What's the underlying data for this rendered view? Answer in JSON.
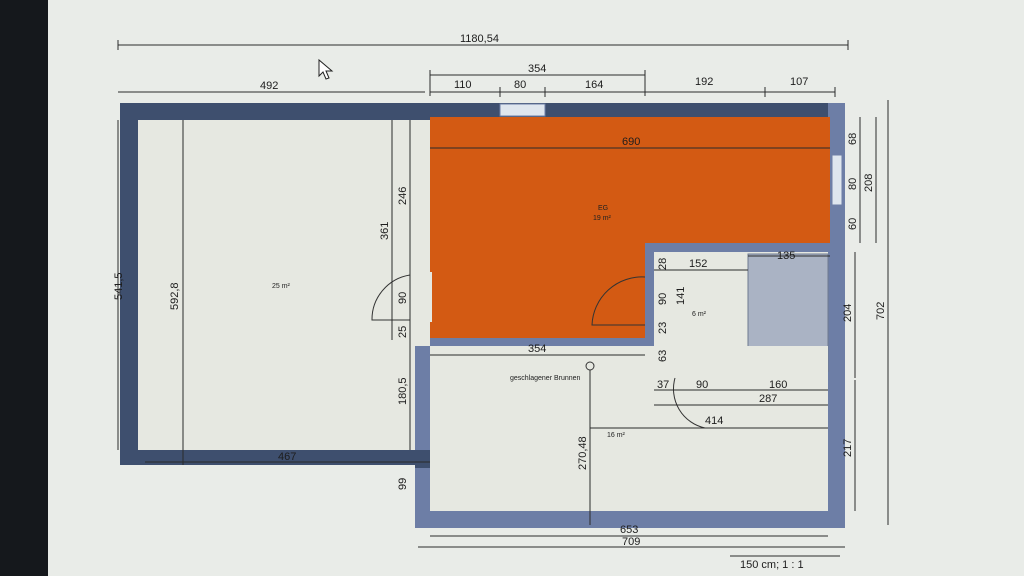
{
  "plan": {
    "dimensions": {
      "total_width": "1180,54",
      "top_left": "492",
      "top_mid_group": "354",
      "seg_110": "110",
      "seg_80": "80",
      "seg_164": "164",
      "seg_192": "192",
      "seg_107": "107",
      "orange_width": "690",
      "right_68": "68",
      "right_80": "80",
      "right_60": "60",
      "right_208": "208",
      "right_702": "702",
      "right_204": "204",
      "right_217": "217",
      "left_541": "541,5",
      "left_592": "592,8",
      "inner_246": "246",
      "inner_361": "361",
      "inner_90": "90",
      "inner_25": "25",
      "inner_180": "180,5",
      "bottom_467": "467",
      "bottom_99": "99",
      "mid_354": "354",
      "bath_28": "28",
      "bath_152": "152",
      "bath_135": "135",
      "bath_90": "90",
      "bath_141": "141",
      "bath_23": "23",
      "bath_63": "63",
      "row_37": "37",
      "row_90": "90",
      "row_160": "160",
      "row_287": "287",
      "row_414": "414",
      "vert_270": "270,48",
      "bottom_653": "653",
      "bottom_709": "709"
    },
    "rooms": {
      "left_area": "25 m²",
      "orange_name": "EG",
      "orange_area": "19 m²",
      "bath_area": "6 m²",
      "bottom_area": "16 m²",
      "well_label": "geschlagener Brunnen"
    },
    "scale": "150 cm; 1 : 1"
  },
  "colors": {
    "wall": "#3e4f6e",
    "orange_room": "#d35a13",
    "floor": "#e6e8e1"
  },
  "icons": {
    "cursor": "mouse-pointer-icon"
  }
}
